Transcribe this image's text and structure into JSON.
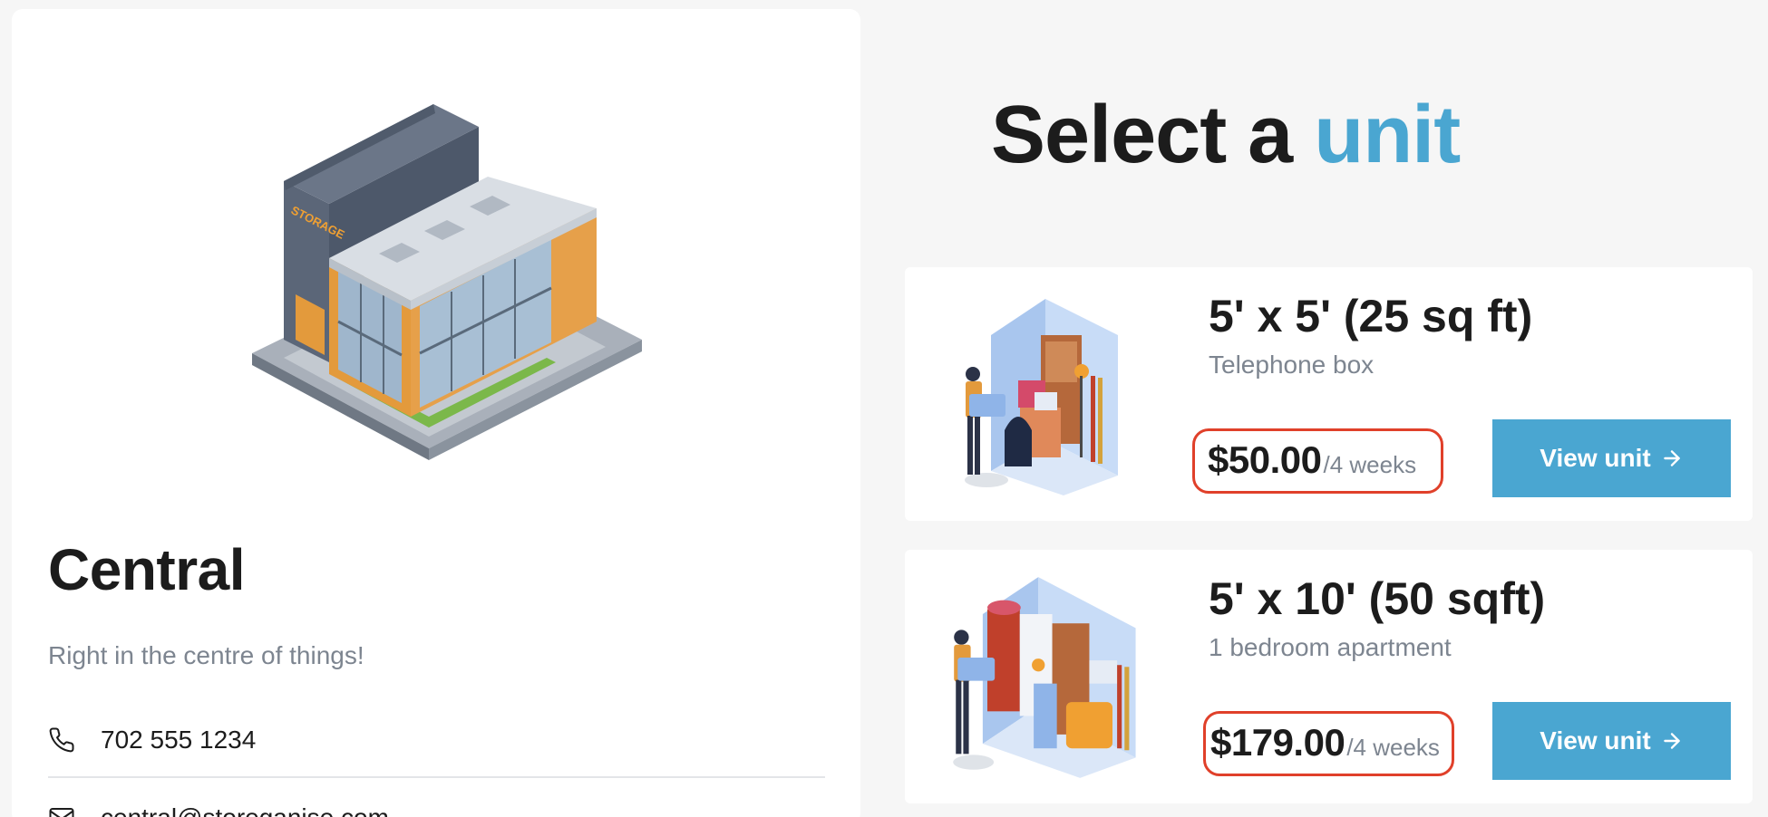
{
  "site": {
    "name": "Central",
    "tagline": "Right in the centre of things!",
    "building_sign": "STORAGE",
    "phone": "702 555 1234",
    "email": "central@storeganise.com"
  },
  "heading": {
    "prefix": "Select a ",
    "accent": "unit",
    "accent_color": "#4aa6d1"
  },
  "units": [
    {
      "title": "5' x 5' (25 sq ft)",
      "description": "Telephone box",
      "price": "$50.00",
      "period": "/4 weeks",
      "button_label": "View unit"
    },
    {
      "title": "5' x 10' (50 sqft)",
      "description": "1 bedroom apartment",
      "price": "$179.00",
      "period": "/4 weeks",
      "button_label": "View unit"
    }
  ],
  "colors": {
    "accent": "#4aa6d1",
    "highlight_outline": "#e0402a",
    "muted_text": "#7d8590"
  },
  "icons": {
    "phone": "phone-icon",
    "email": "mail-icon",
    "arrow": "arrow-right-icon"
  }
}
